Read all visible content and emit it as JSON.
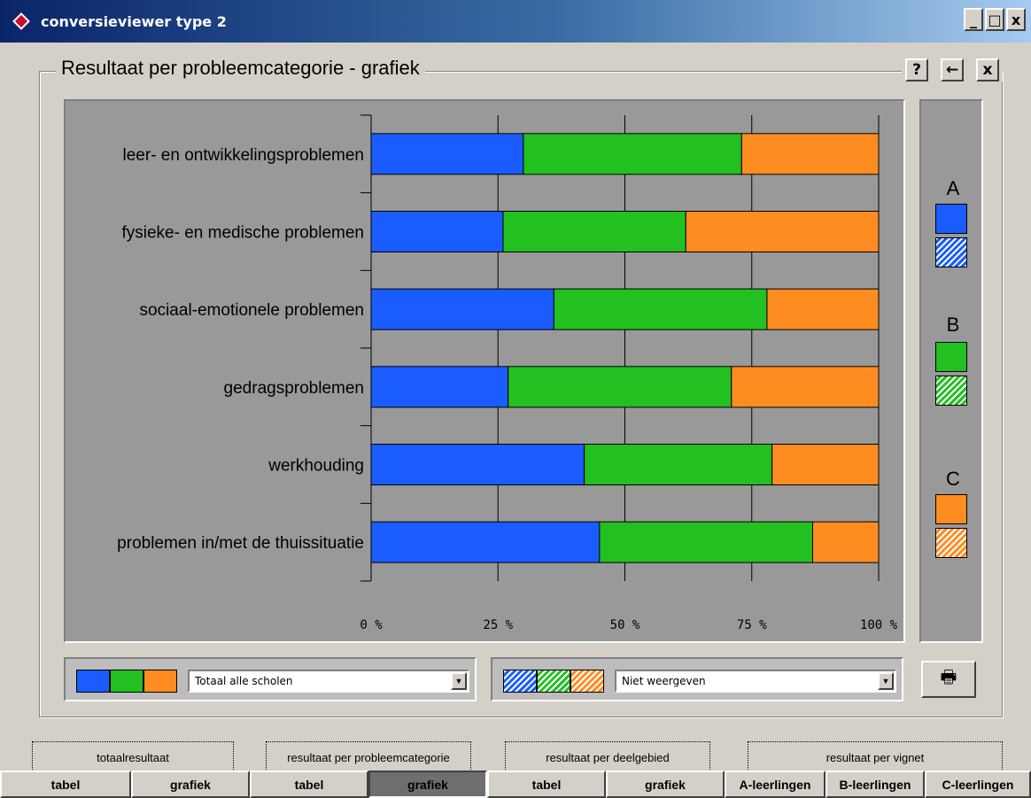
{
  "window": {
    "title": "conversieviewer type 2",
    "buttons": [
      "_",
      "□",
      "x"
    ]
  },
  "header": {
    "title": "Resultaat per probleemcategorie - grafiek",
    "help": "?",
    "back": "←",
    "close": "x"
  },
  "chart_data": {
    "type": "bar",
    "orientation": "horizontal",
    "stacked": true,
    "categories": [
      "leer- en ontwikkelingsproblemen",
      "fysieke- en medische problemen",
      "sociaal-emotionele problemen",
      "gedragsproblemen",
      "werkhouding",
      "problemen in/met de thuissituatie"
    ],
    "series": [
      {
        "name": "A",
        "color": "#1a5cff",
        "values": [
          30,
          26,
          36,
          27,
          42,
          45
        ]
      },
      {
        "name": "B",
        "color": "#22c020",
        "values": [
          43,
          36,
          42,
          44,
          37,
          42
        ]
      },
      {
        "name": "C",
        "color": "#ff8c20",
        "values": [
          27,
          38,
          22,
          29,
          21,
          13
        ]
      }
    ],
    "xticks": [
      "0 %",
      "25 %",
      "50 %",
      "75 %",
      "100 %"
    ],
    "xlim": [
      0,
      100
    ],
    "grid": true,
    "legend": "right"
  },
  "legend": {
    "a": "A",
    "b": "B",
    "c": "C"
  },
  "controls": {
    "left_select": "Totaal alle scholen",
    "right_select": "Niet weergeven",
    "arrow": "▼",
    "print_icon": "🖶"
  },
  "tabs": {
    "groups": [
      "totaalresultaat",
      "resultaat per probleemcategorie",
      "resultaat per deelgebied",
      "resultaat per vignet"
    ],
    "buttons": [
      "tabel",
      "grafiek",
      "tabel",
      "grafiek",
      "tabel",
      "grafiek",
      "A-leerlingen",
      "B-leerlingen",
      "C-leerlingen"
    ]
  }
}
